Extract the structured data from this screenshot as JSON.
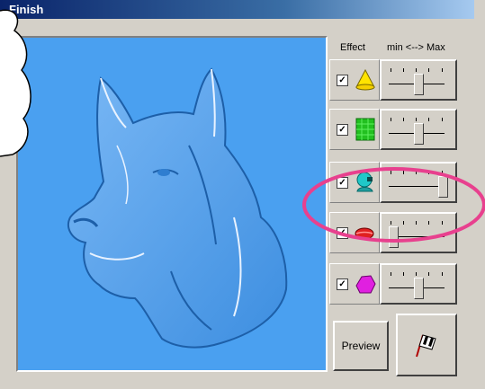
{
  "window": {
    "title": "Finish"
  },
  "effects": {
    "header_effect": "Effect",
    "header_range": "min <--> Max",
    "rows": [
      {
        "icon": "yellow-cone-icon",
        "checked": true,
        "check_mark": "✓",
        "level": 0.5
      },
      {
        "icon": "green-texture-icon",
        "checked": true,
        "check_mark": "✓",
        "level": 0.5
      },
      {
        "icon": "teal-head-icon",
        "checked": true,
        "check_mark": "✓",
        "level": 1.0
      },
      {
        "icon": "red-lips-icon",
        "checked": true,
        "check_mark": "✓",
        "level": 0.0
      },
      {
        "icon": "magenta-shape-icon",
        "checked": true,
        "check_mark": "✓",
        "level": 0.5
      }
    ]
  },
  "buttons": {
    "preview_label": "Preview",
    "finish_icon": "checkered-flag-icon"
  },
  "colors": {
    "canvas_bg": "#4aa0f0",
    "highlight": "#e8408e",
    "titlebar": "#0a246a"
  }
}
